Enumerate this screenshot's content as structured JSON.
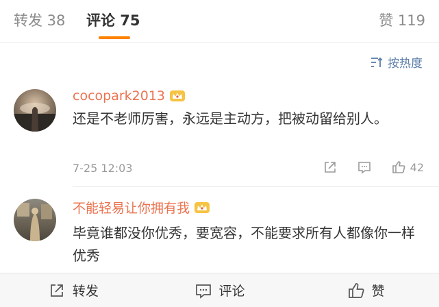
{
  "tabs": {
    "repost": "转发 38",
    "comments": "评论 75",
    "likes": "赞 119"
  },
  "sort": {
    "label": "按热度"
  },
  "comments": [
    {
      "username": "cocopark2013",
      "text": "还是不老师厉害，永远是主动方，把被动留给别人。",
      "time": "7-25 12:03",
      "like_count": "42",
      "avatar_icon": "avatar-photo",
      "badge_icon": "crown-icon"
    },
    {
      "username": "不能轻易让你拥有我",
      "text": "毕竟谁都没你优秀，要宽容，不能要求所有人都像你一样优秀",
      "badge_icon": "crown-icon"
    }
  ],
  "bottom_bar": {
    "repost": "转发",
    "comment": "评论",
    "like": "赞"
  },
  "colors": {
    "accent": "#ff8200",
    "username": "#eb7350",
    "link_blue": "#5b7ea8",
    "muted": "#9a9a9a"
  }
}
